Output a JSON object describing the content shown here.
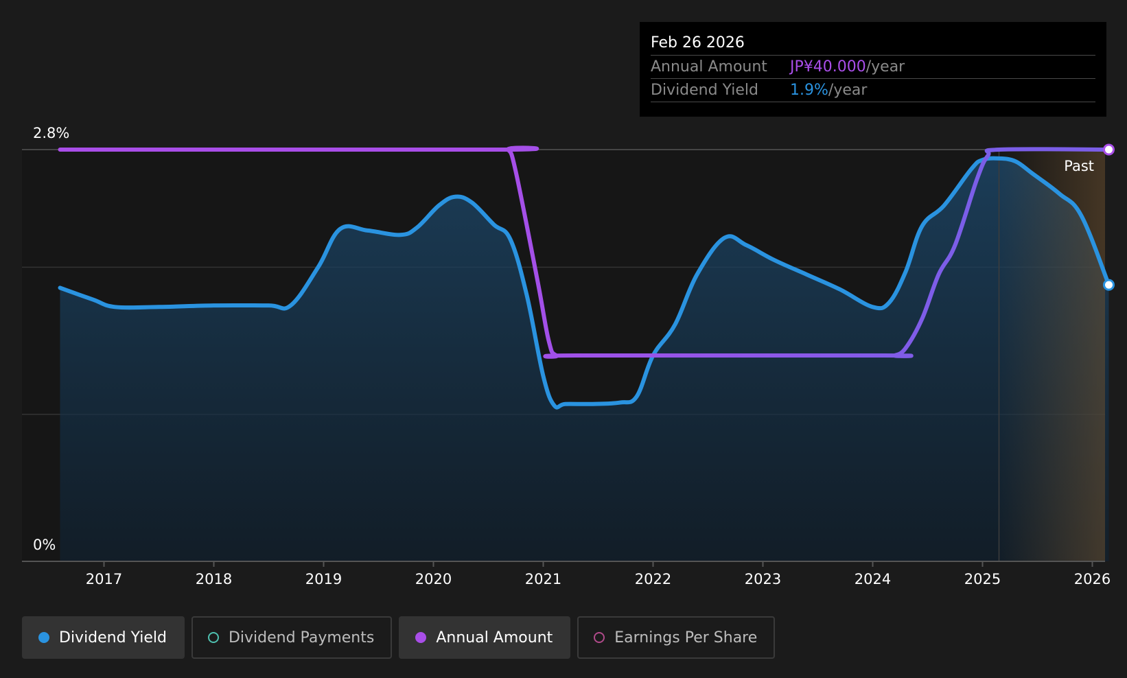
{
  "chart_data": {
    "type": "line",
    "x_axis": {
      "tick_labels": [
        "2017",
        "2018",
        "2019",
        "2020",
        "2021",
        "2022",
        "2023",
        "2024",
        "2025",
        "2026"
      ],
      "range": [
        2016.3,
        2026.2
      ]
    },
    "y_axis": {
      "tick_labels": [
        "0%",
        "2.8%"
      ],
      "range_percent": [
        0,
        2.8
      ],
      "gridlines_percent": [
        1.0,
        2.0,
        2.8
      ]
    },
    "series": [
      {
        "name": "Dividend Yield",
        "color": "#2a93e0",
        "area_fill": true,
        "x": [
          2016.6,
          2016.9,
          2017.1,
          2017.5,
          2018.0,
          2018.5,
          2018.7,
          2018.95,
          2019.15,
          2019.4,
          2019.7,
          2019.85,
          2020.05,
          2020.2,
          2020.35,
          2020.55,
          2020.7,
          2020.85,
          2021.0,
          2021.1,
          2021.2,
          2021.45,
          2021.7,
          2021.85,
          2022.0,
          2022.2,
          2022.4,
          2022.65,
          2022.85,
          2023.1,
          2023.4,
          2023.7,
          2024.0,
          2024.15,
          2024.3,
          2024.45,
          2024.65,
          2024.9,
          2025.0,
          2025.15,
          2025.3,
          2025.45,
          2025.7,
          2025.9,
          2026.15
        ],
        "y": [
          1.86,
          1.78,
          1.73,
          1.73,
          1.74,
          1.74,
          1.74,
          2.0,
          2.26,
          2.25,
          2.22,
          2.27,
          2.42,
          2.48,
          2.44,
          2.29,
          2.19,
          1.81,
          1.26,
          1.06,
          1.07,
          1.07,
          1.08,
          1.12,
          1.4,
          1.61,
          1.95,
          2.2,
          2.15,
          2.05,
          1.95,
          1.85,
          1.73,
          1.76,
          1.97,
          2.28,
          2.42,
          2.67,
          2.73,
          2.74,
          2.72,
          2.64,
          2.5,
          2.35,
          1.88
        ]
      },
      {
        "name": "Annual Amount",
        "color": "#a94ee8",
        "gradient_end_color": "#7b5ee8",
        "x": [
          2016.6,
          2020.6,
          2020.68,
          2020.75,
          2020.95,
          2021.05,
          2021.12,
          2021.3,
          2024.1,
          2024.2,
          2024.3,
          2024.45,
          2024.6,
          2024.75,
          2024.95,
          2025.05,
          2025.15,
          2026.15
        ],
        "y": [
          2.8,
          2.8,
          2.8,
          2.65,
          1.9,
          1.5,
          1.4,
          1.4,
          1.4,
          1.4,
          1.45,
          1.65,
          1.95,
          2.15,
          2.6,
          2.76,
          2.8,
          2.8
        ]
      }
    ],
    "past_marker": {
      "x": 2025.15,
      "label": "Past"
    },
    "tooltip": {
      "date": "Feb 26 2026",
      "rows": [
        {
          "label": "Annual Amount",
          "value": "JP¥40.000",
          "unit": "/year",
          "color": "#a94ee8"
        },
        {
          "label": "Dividend Yield",
          "value": "1.9%",
          "unit": "/year",
          "color": "#2a93e0"
        }
      ]
    },
    "legend": [
      {
        "label": "Dividend Yield",
        "color": "#2a93e0",
        "style": "filled",
        "active": true
      },
      {
        "label": "Dividend Payments",
        "color": "#4fc1b0",
        "style": "hollow",
        "active": false
      },
      {
        "label": "Annual Amount",
        "color": "#a94ee8",
        "style": "filled",
        "active": true
      },
      {
        "label": "Earnings Per Share",
        "color": "#b04a8a",
        "style": "hollow",
        "active": false
      }
    ]
  }
}
